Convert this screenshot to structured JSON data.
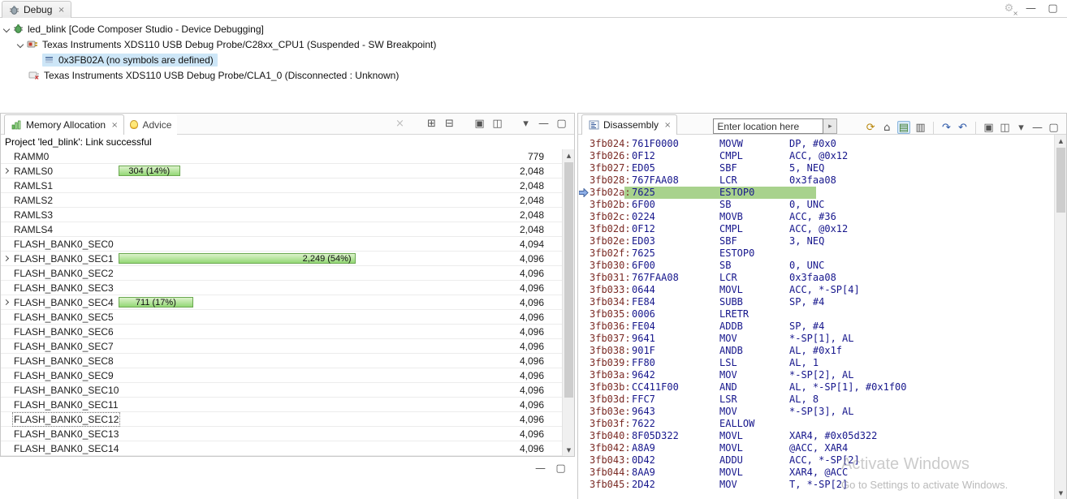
{
  "colors": {
    "address": "#7a2a24",
    "code": "#16168c",
    "current_line_bg": "#a8d28d",
    "bar_border": "#6aa84f",
    "bar_fill_top": "#dcf2cb",
    "bar_fill_bottom": "#94d876",
    "selection_bg": "#cde6f7"
  },
  "icons": {
    "close": "×",
    "clear": "×",
    "minimize": "—",
    "maximize": "▢",
    "menu_chevron": "▾",
    "expand_all": "⊞",
    "collapse_all": "⊟",
    "window": "▣",
    "window_alt": "◫",
    "refresh": "⟳",
    "home": "⌂",
    "show_source": "▤",
    "show_opcodes": "▥",
    "jump_pc": "↷",
    "jump_back": "↶",
    "scroll_up": "▲",
    "scroll_down": "▼",
    "gear": "⚙",
    "input_go": "▸"
  },
  "debug_view": {
    "tab_label": "Debug",
    "tree": [
      {
        "label": "led_blink [Code Composer Studio - Device Debugging]",
        "indent": 0,
        "expander": true,
        "icon": "bug",
        "selected": false
      },
      {
        "label": "Texas Instruments XDS110 USB Debug Probe/C28xx_CPU1 (Suspended - SW Breakpoint)",
        "indent": 1,
        "expander": true,
        "icon": "probe",
        "selected": false
      },
      {
        "label": "0x3FB02A  (no symbols are defined)",
        "indent": 2,
        "expander": false,
        "icon": "frame",
        "selected": true
      },
      {
        "label": "Texas Instruments XDS110 USB Debug Probe/CLA1_0 (Disconnected : Unknown)",
        "indent": 1,
        "expander": false,
        "icon": "probe_x",
        "selected": false
      }
    ]
  },
  "memory_panel": {
    "tabs": [
      {
        "label": "Memory Allocation",
        "active": true
      },
      {
        "label": "Advice",
        "active": false
      }
    ],
    "status_line": "Project 'led_blink': Link successful",
    "rows": [
      {
        "name": "RAMM0",
        "size": "779"
      },
      {
        "name": "RAMLS0",
        "size": "2,048",
        "expandable": true,
        "bar": {
          "label": "304 (14%)",
          "pct": 14,
          "align": "center"
        }
      },
      {
        "name": "RAMLS1",
        "size": "2,048"
      },
      {
        "name": "RAMLS2",
        "size": "2,048"
      },
      {
        "name": "RAMLS3",
        "size": "2,048"
      },
      {
        "name": "RAMLS4",
        "size": "2,048"
      },
      {
        "name": "FLASH_BANK0_SEC0",
        "size": "4,094"
      },
      {
        "name": "FLASH_BANK0_SEC1",
        "size": "4,096",
        "expandable": true,
        "bar": {
          "label": "2,249 (54%)",
          "pct": 54,
          "align": "right"
        }
      },
      {
        "name": "FLASH_BANK0_SEC2",
        "size": "4,096"
      },
      {
        "name": "FLASH_BANK0_SEC3",
        "size": "4,096"
      },
      {
        "name": "FLASH_BANK0_SEC4",
        "size": "4,096",
        "expandable": true,
        "bar": {
          "label": "711 (17%)",
          "pct": 17,
          "align": "center"
        }
      },
      {
        "name": "FLASH_BANK0_SEC5",
        "size": "4,096"
      },
      {
        "name": "FLASH_BANK0_SEC6",
        "size": "4,096"
      },
      {
        "name": "FLASH_BANK0_SEC7",
        "size": "4,096"
      },
      {
        "name": "FLASH_BANK0_SEC8",
        "size": "4,096"
      },
      {
        "name": "FLASH_BANK0_SEC9",
        "size": "4,096"
      },
      {
        "name": "FLASH_BANK0_SEC10",
        "size": "4,096"
      },
      {
        "name": "FLASH_BANK0_SEC11",
        "size": "4,096"
      },
      {
        "name": "FLASH_BANK0_SEC12",
        "size": "4,096",
        "focused": true
      },
      {
        "name": "FLASH_BANK0_SEC13",
        "size": "4,096"
      },
      {
        "name": "FLASH_BANK0_SEC14",
        "size": "4,096"
      }
    ]
  },
  "disassembly_panel": {
    "tab_label": "Disassembly",
    "location_placeholder": "Enter location here",
    "rows": [
      {
        "address": "3fb024:",
        "opcode": "761F0000",
        "mnemonic": "MOVW",
        "operands": "DP, #0x0"
      },
      {
        "address": "3fb026:",
        "opcode": "0F12",
        "mnemonic": "CMPL",
        "operands": "ACC, @0x12"
      },
      {
        "address": "3fb027:",
        "opcode": "ED05",
        "mnemonic": "SBF",
        "operands": "5, NEQ"
      },
      {
        "address": "3fb028:",
        "opcode": "767FAA08",
        "mnemonic": "LCR",
        "operands": "0x3faa08"
      },
      {
        "address": "3fb02a:",
        "opcode": "7625",
        "mnemonic": "ESTOP0",
        "operands": "",
        "current": true
      },
      {
        "address": "3fb02b:",
        "opcode": "6F00",
        "mnemonic": "SB",
        "operands": "0, UNC"
      },
      {
        "address": "3fb02c:",
        "opcode": "0224",
        "mnemonic": "MOVB",
        "operands": "ACC, #36"
      },
      {
        "address": "3fb02d:",
        "opcode": "0F12",
        "mnemonic": "CMPL",
        "operands": "ACC, @0x12"
      },
      {
        "address": "3fb02e:",
        "opcode": "ED03",
        "mnemonic": "SBF",
        "operands": "3, NEQ"
      },
      {
        "address": "3fb02f:",
        "opcode": "7625",
        "mnemonic": "ESTOP0",
        "operands": ""
      },
      {
        "address": "3fb030:",
        "opcode": "6F00",
        "mnemonic": "SB",
        "operands": "0, UNC"
      },
      {
        "address": "3fb031:",
        "opcode": "767FAA08",
        "mnemonic": "LCR",
        "operands": "0x3faa08"
      },
      {
        "address": "3fb033:",
        "opcode": "0644",
        "mnemonic": "MOVL",
        "operands": "ACC, *-SP[4]"
      },
      {
        "address": "3fb034:",
        "opcode": "FE84",
        "mnemonic": "SUBB",
        "operands": "SP, #4"
      },
      {
        "address": "3fb035:",
        "opcode": "0006",
        "mnemonic": "LRETR",
        "operands": ""
      },
      {
        "address": "3fb036:",
        "opcode": "FE04",
        "mnemonic": "ADDB",
        "operands": "SP, #4"
      },
      {
        "address": "3fb037:",
        "opcode": "9641",
        "mnemonic": "MOV",
        "operands": "*-SP[1], AL"
      },
      {
        "address": "3fb038:",
        "opcode": "901F",
        "mnemonic": "ANDB",
        "operands": "AL, #0x1f"
      },
      {
        "address": "3fb039:",
        "opcode": "FF80",
        "mnemonic": "LSL",
        "operands": "AL, 1"
      },
      {
        "address": "3fb03a:",
        "opcode": "9642",
        "mnemonic": "MOV",
        "operands": "*-SP[2], AL"
      },
      {
        "address": "3fb03b:",
        "opcode": "CC411F00",
        "mnemonic": "AND",
        "operands": "AL, *-SP[1], #0x1f00"
      },
      {
        "address": "3fb03d:",
        "opcode": "FFC7",
        "mnemonic": "LSR",
        "operands": "AL, 8"
      },
      {
        "address": "3fb03e:",
        "opcode": "9643",
        "mnemonic": "MOV",
        "operands": "*-SP[3], AL"
      },
      {
        "address": "3fb03f:",
        "opcode": "7622",
        "mnemonic": "EALLOW",
        "operands": ""
      },
      {
        "address": "3fb040:",
        "opcode": "8F05D322",
        "mnemonic": "MOVL",
        "operands": "XAR4, #0x05d322"
      },
      {
        "address": "3fb042:",
        "opcode": "A8A9",
        "mnemonic": "MOVL",
        "operands": "@ACC, XAR4"
      },
      {
        "address": "3fb043:",
        "opcode": "0D42",
        "mnemonic": "ADDU",
        "operands": "ACC, *-SP[2]"
      },
      {
        "address": "3fb044:",
        "opcode": "8AA9",
        "mnemonic": "MOVL",
        "operands": "XAR4, @ACC"
      },
      {
        "address": "3fb045:",
        "opcode": "2D42",
        "mnemonic": "MOV",
        "operands": "T, *-SP[2]"
      }
    ]
  },
  "watermark": {
    "line1": "Activate Windows",
    "line2": "Go to Settings to activate Windows."
  }
}
